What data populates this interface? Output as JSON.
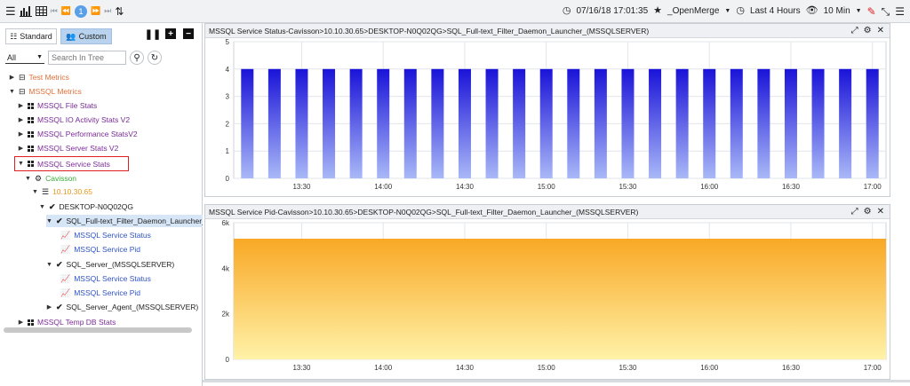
{
  "topbar": {
    "page_number": "1",
    "datetime": "07/16/18 17:01:35",
    "favorite": "_OpenMerge",
    "time_range": "Last 4 Hours",
    "interval": "10 Min"
  },
  "sidebar": {
    "tabs": {
      "standard": "Standard",
      "custom": "Custom"
    },
    "filter": {
      "select_value": "All",
      "search_placeholder": "Search In Tree"
    },
    "tree": [
      {
        "label": "Test Metrics",
        "color": "#e2703a"
      },
      {
        "label": "MSSQL Metrics",
        "color": "#e2703a"
      },
      {
        "label": "MSSQL File Stats",
        "color": "#7a2b96"
      },
      {
        "label": "MSSQL IO Activity Stats V2",
        "color": "#7a2b96"
      },
      {
        "label": "MSSQL Performance StatsV2",
        "color": "#7a2b96"
      },
      {
        "label": "MSSQL Server Stats V2",
        "color": "#7a2b96"
      },
      {
        "label": "MSSQL Service Stats",
        "color": "#7a2b96"
      },
      {
        "label": "Cavisson",
        "color": "#3aaa35"
      },
      {
        "label": "10.10.30.65",
        "color": "#e8961e"
      },
      {
        "label": "DESKTOP-N0Q02QG",
        "color": "#222222"
      },
      {
        "label": "SQL_Full-text_Filter_Daemon_Launcher_(M",
        "color": "#222222"
      },
      {
        "label": "MSSQL Service Status",
        "color": "#2f54c6"
      },
      {
        "label": "MSSQL Service Pid",
        "color": "#2f54c6"
      },
      {
        "label": "SQL_Server_(MSSQLSERVER)",
        "color": "#222222"
      },
      {
        "label": "MSSQL Service Status",
        "color": "#2f54c6"
      },
      {
        "label": "MSSQL Service Pid",
        "color": "#2f54c6"
      },
      {
        "label": "SQL_Server_Agent_(MSSQLSERVER)",
        "color": "#222222"
      },
      {
        "label": "MSSQL Temp DB Stats",
        "color": "#7a2b96"
      }
    ]
  },
  "chart_data": [
    {
      "type": "bar",
      "title": "MSSQL Service Status-Cavisson>10.10.30.65>DESKTOP-N0Q02QG>SQL_Full-text_Filter_Daemon_Launcher_(MSSQLSERVER)",
      "x_ticks": [
        "13:30",
        "14:00",
        "14:30",
        "15:00",
        "15:30",
        "16:00",
        "16:30",
        "17:00"
      ],
      "x_range": [
        "13:05",
        "17:05"
      ],
      "y_ticks": [
        "0",
        "1",
        "2",
        "3",
        "4",
        "5"
      ],
      "ylim": [
        0,
        5
      ],
      "series": [
        {
          "x": [
            "13:10",
            "13:20",
            "13:30",
            "13:40",
            "13:50",
            "14:00",
            "14:10",
            "14:20",
            "14:30",
            "14:40",
            "14:50",
            "15:00",
            "15:10",
            "15:20",
            "15:30",
            "15:40",
            "15:50",
            "16:00",
            "16:10",
            "16:20",
            "16:30",
            "16:40",
            "16:50",
            "17:00"
          ],
          "values": [
            4,
            4,
            4,
            4,
            4,
            4,
            4,
            4,
            4,
            4,
            4,
            4,
            4,
            4,
            4,
            4,
            4,
            4,
            4,
            4,
            4,
            4,
            4,
            4
          ]
        }
      ],
      "colors": {
        "top": "#1a13d8",
        "bottom": "#a9b8f7"
      },
      "grid": true
    },
    {
      "type": "area",
      "title": "MSSQL Service Pid-Cavisson>10.10.30.65>DESKTOP-N0Q02QG>SQL_Full-text_Filter_Daemon_Launcher_(MSSQLSERVER)",
      "x_ticks": [
        "13:30",
        "14:00",
        "14:30",
        "15:00",
        "15:30",
        "16:00",
        "16:30",
        "17:00"
      ],
      "x_range": [
        "13:05",
        "17:05"
      ],
      "y_ticks": [
        "0",
        "2k",
        "4k",
        "6k"
      ],
      "ylim": [
        0,
        6000
      ],
      "series": [
        {
          "x": [
            "13:05",
            "17:05"
          ],
          "values": [
            5300,
            5300
          ]
        }
      ],
      "colors": {
        "top": "#f9a825",
        "bottom": "#fff2a8"
      },
      "grid": true
    }
  ]
}
